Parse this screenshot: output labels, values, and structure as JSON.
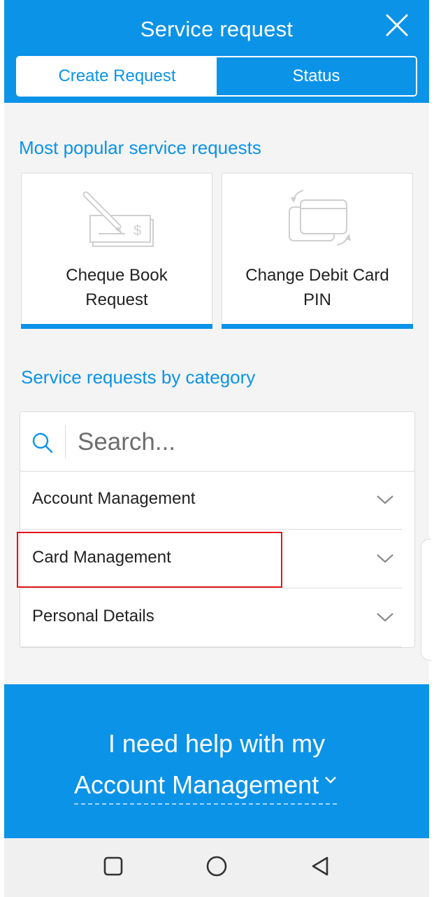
{
  "header": {
    "title": "Service request",
    "close_icon": "close-icon",
    "tabs": [
      {
        "label": "Create Request",
        "active": true
      },
      {
        "label": "Status",
        "active": false
      }
    ]
  },
  "popular": {
    "title": "Most popular service requests",
    "cards": [
      {
        "label_line1": "Cheque Book",
        "label_line2": "Request",
        "icon": "cheque-icon"
      },
      {
        "label_line1": "Change Debit Card",
        "label_line2": "PIN",
        "icon": "card-swap-icon"
      }
    ]
  },
  "category": {
    "title": "Service requests by category",
    "search_placeholder": "Search...",
    "items": [
      {
        "label": "Account Management"
      },
      {
        "label": "Card Management"
      },
      {
        "label": "Personal Details"
      }
    ]
  },
  "help": {
    "line1": "I need help with my",
    "selected": "Account Management"
  },
  "colors": {
    "brand_blue": "#0b93e8",
    "highlight_red": "#e3141b",
    "background": "#f4f4f4"
  },
  "navbar": {
    "icons": [
      "recent-apps-icon",
      "home-icon",
      "back-icon"
    ]
  }
}
